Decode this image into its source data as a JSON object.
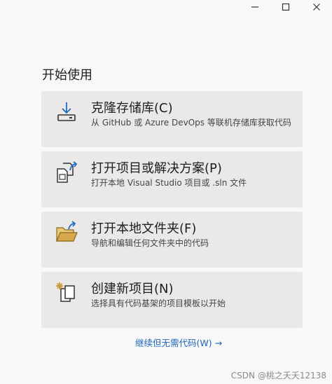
{
  "window": {
    "controls": [
      "minimize-icon",
      "maximize-icon",
      "close-icon"
    ]
  },
  "heading": "开始使用",
  "cards": [
    {
      "icon": "clone-download-icon",
      "title": "克隆存储库(C)",
      "desc": "从 GitHub 或 Azure DevOps 等联机存储库获取代码"
    },
    {
      "icon": "open-project-icon",
      "title": "打开项目或解决方案(P)",
      "desc": "打开本地 Visual Studio 项目或 .sln 文件"
    },
    {
      "icon": "open-folder-icon",
      "title": "打开本地文件夹(F)",
      "desc": "导航和编辑任何文件夹中的代码"
    },
    {
      "icon": "new-project-icon",
      "title": "创建新项目(N)",
      "desc": "选择具有代码基架的项目模板以开始"
    }
  ],
  "continue_link": "继续但无需代码(W) →",
  "watermark": "CSDN @桃之夭夭12138",
  "colors": {
    "background": "#f9f8f8",
    "card": "#ebe8e8",
    "link": "#2067b8",
    "accent_blue": "#1e6cc8",
    "folder": "#c69a3c"
  }
}
